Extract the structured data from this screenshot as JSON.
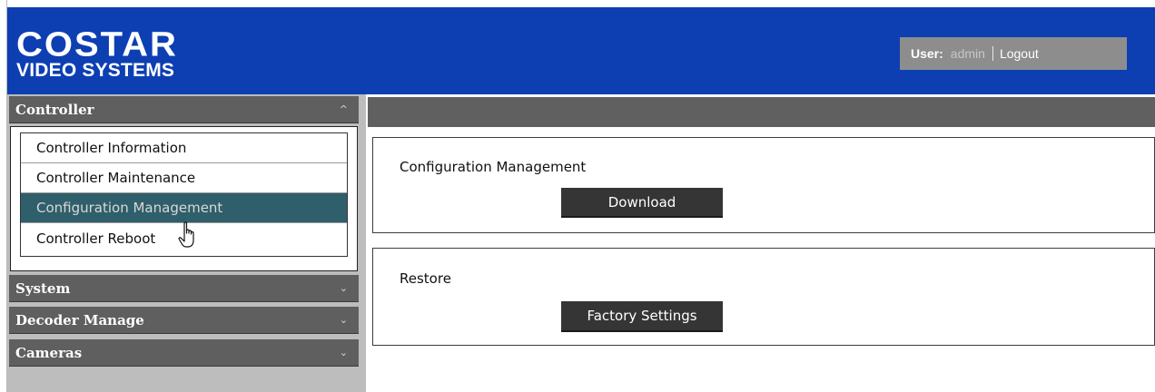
{
  "header": {
    "logo_main": "COSTAR",
    "logo_sub": "VIDEO SYSTEMS",
    "user_label": "User:",
    "user_name": "admin",
    "logout_label": "Logout"
  },
  "sidebar": {
    "sections": [
      {
        "label": "Controller",
        "chevron": "^",
        "expanded": true
      },
      {
        "label": "System",
        "chevron": "⌄",
        "expanded": false
      },
      {
        "label": "Decoder Manage",
        "chevron": "⌄",
        "expanded": false
      },
      {
        "label": "Cameras",
        "chevron": "⌄",
        "expanded": false
      }
    ],
    "controller_items": [
      {
        "label": "Controller Information"
      },
      {
        "label": "Controller Maintenance"
      },
      {
        "label": "Configuration Management",
        "active": true
      },
      {
        "label": "Controller Reboot"
      }
    ]
  },
  "main": {
    "config_panel": {
      "title": "Configuration Management",
      "button_label": "Download"
    },
    "restore_panel": {
      "title": "Restore",
      "button_label": "Factory Settings"
    }
  },
  "colors": {
    "header_bg": "#0d3fb3",
    "active_item_bg": "#2f5f6a",
    "section_header_bg": "#5f5f5f",
    "button_bg": "#353535"
  },
  "icons": [
    "chevron-up-icon",
    "chevron-down-icon",
    "hand-pointer-cursor-icon"
  ]
}
